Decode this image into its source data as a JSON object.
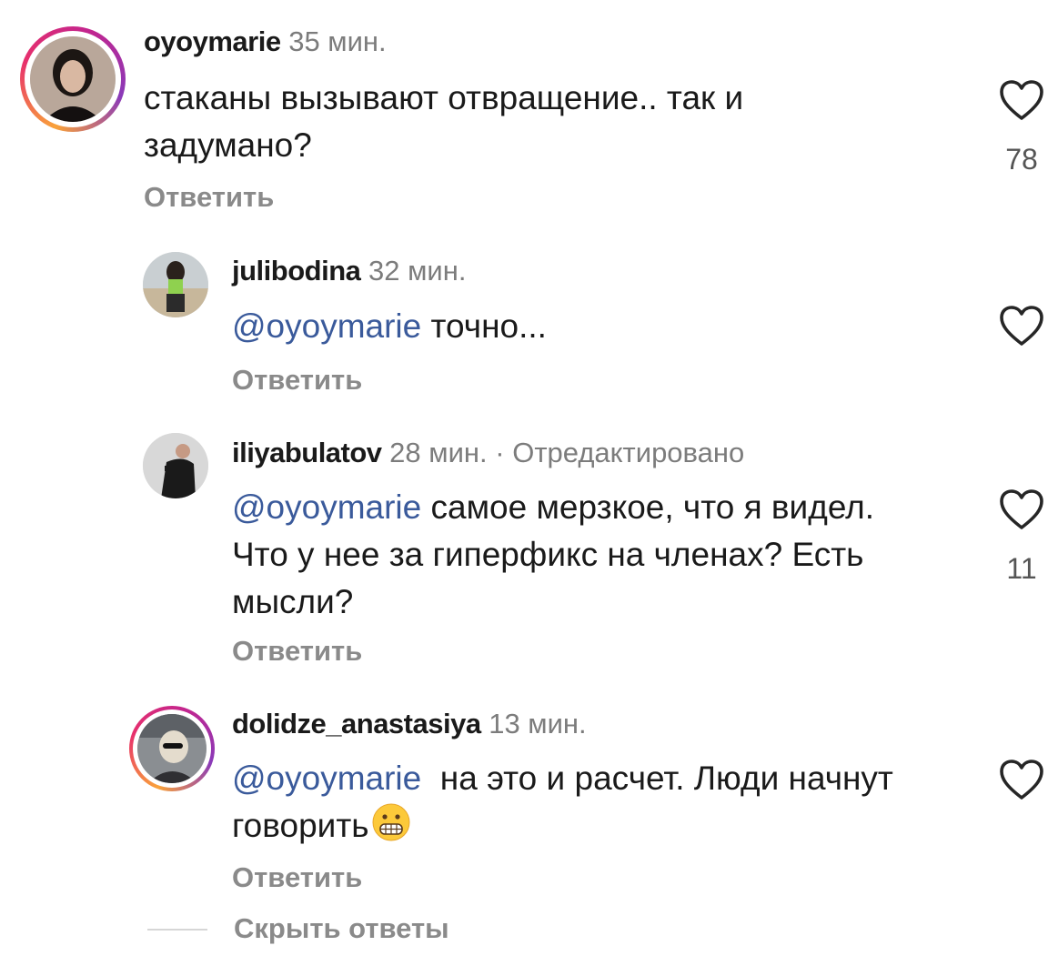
{
  "comments": [
    {
      "username": "oyoymarie",
      "time": "35 мин.",
      "text": "стаканы вызывают отвращение.. так и задумано?",
      "reply_label": "Ответить",
      "likes": "78"
    },
    {
      "username": "julibodina",
      "time": "32 мин.",
      "mention": "@oyoymarie",
      "text": "точно...",
      "reply_label": "Ответить"
    },
    {
      "username": "iliyabulatov",
      "time": "28 мин.",
      "edited": "· Отредактировано",
      "mention": "@oyoymarie",
      "text": "самое мерзкое, что я видел. Что у нее за гиперфикс на членах? Есть мысли?",
      "reply_label": "Ответить",
      "likes": "11"
    },
    {
      "username": "dolidze_anastasiya",
      "time": "13 мин.",
      "mention": "@oyoymarie",
      "text": "на это и расчет. Люди начнут говорить",
      "emoji": "grimacing-face",
      "reply_label": "Ответить"
    }
  ],
  "hide_replies": "Скрыть ответы",
  "icons": {
    "like": "heart-outline-icon"
  },
  "colors": {
    "mention": "#3a5a9b",
    "secondary_text": "#8a8a8a"
  }
}
